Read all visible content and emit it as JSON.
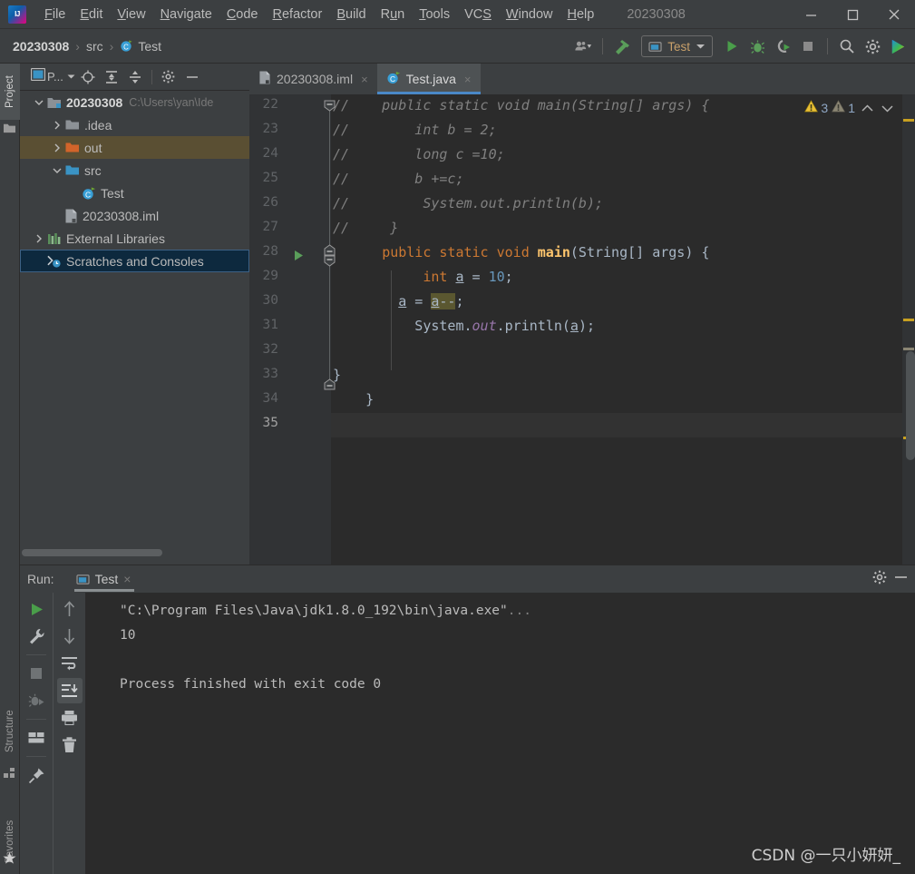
{
  "window": {
    "title": "20230308",
    "app_logo_icon": "intellij-idea-logo",
    "controls": [
      {
        "name": "minimize-button",
        "icon": "minimize-icon"
      },
      {
        "name": "maximize-button",
        "icon": "maximize-icon"
      },
      {
        "name": "close-button",
        "icon": "close-icon"
      }
    ]
  },
  "menubar": {
    "items": [
      {
        "label": "File",
        "mnemonic": "F"
      },
      {
        "label": "Edit",
        "mnemonic": "E"
      },
      {
        "label": "View",
        "mnemonic": "V"
      },
      {
        "label": "Navigate",
        "mnemonic": "N"
      },
      {
        "label": "Code",
        "mnemonic": "C"
      },
      {
        "label": "Refactor",
        "mnemonic": "R"
      },
      {
        "label": "Build",
        "mnemonic": "B"
      },
      {
        "label": "Run",
        "mnemonic": "u"
      },
      {
        "label": "Tools",
        "mnemonic": "T"
      },
      {
        "label": "VCS",
        "mnemonic": "S"
      },
      {
        "label": "Window",
        "mnemonic": "W"
      },
      {
        "label": "Help",
        "mnemonic": "H"
      }
    ]
  },
  "breadcrumb": {
    "items": [
      {
        "label": "20230308",
        "bold": true,
        "icon": ""
      },
      {
        "label": "src",
        "bold": false,
        "icon": ""
      },
      {
        "label": "Test",
        "bold": false,
        "icon": "java-class-icon"
      }
    ],
    "separator": "›"
  },
  "toolbar": {
    "buttons": [
      {
        "name": "user-settings-button",
        "icon": "person-dropdown-icon"
      },
      {
        "name": "build-project-button",
        "icon": "hammer-icon"
      },
      {
        "name": "run-button",
        "icon": "run-play-icon"
      },
      {
        "name": "debug-button",
        "icon": "debug-bug-icon"
      },
      {
        "name": "run-with-coverage-button",
        "icon": "coverage-icon"
      },
      {
        "name": "stop-button",
        "icon": "stop-square-icon"
      },
      {
        "name": "search-everywhere-button",
        "icon": "search-icon"
      },
      {
        "name": "settings-button",
        "icon": "gear-icon"
      },
      {
        "name": "idea-help-button",
        "icon": "idea-arrow-icon"
      }
    ],
    "run_config": {
      "label": "Test",
      "icon": "run-config-icon",
      "chevron": "chevron-down-icon"
    }
  },
  "left_tool_strip": {
    "top": [
      {
        "label": "Project",
        "icon": "project-folder-icon",
        "active": true
      }
    ],
    "bottom": [
      {
        "label": "Structure",
        "icon": "structure-icon",
        "active": false
      },
      {
        "label": "Favorites",
        "icon": "star-icon",
        "active": false
      }
    ]
  },
  "project_panel": {
    "title": "P...",
    "header_buttons": [
      {
        "name": "project-view-selector",
        "icon": "project-view-icon"
      },
      {
        "name": "scroll-from-source-button",
        "icon": "target-crosshair-icon"
      },
      {
        "name": "expand-all-button",
        "icon": "expand-all-icon"
      },
      {
        "name": "collapse-all-button",
        "icon": "collapse-all-icon"
      },
      {
        "name": "panel-settings-button",
        "icon": "gear-icon"
      },
      {
        "name": "hide-panel-button",
        "icon": "minimize-icon"
      }
    ],
    "tree": [
      {
        "label": "20230308",
        "secondary": "C:\\Users\\yan\\Ide",
        "icon": "module-folder-icon",
        "arrow": "chevron-down-icon",
        "depth": 0,
        "bold": true,
        "state": "normal"
      },
      {
        "label": ".idea",
        "secondary": "",
        "icon": "folder-gray-icon",
        "arrow": "chevron-right-icon",
        "depth": 1,
        "bold": false,
        "state": "normal"
      },
      {
        "label": "out",
        "secondary": "",
        "icon": "folder-orange-icon",
        "arrow": "chevron-right-icon",
        "depth": 1,
        "bold": false,
        "state": "selected-inactive"
      },
      {
        "label": "src",
        "secondary": "",
        "icon": "folder-source-icon",
        "arrow": "chevron-down-icon",
        "depth": 1,
        "bold": false,
        "state": "normal"
      },
      {
        "label": "Test",
        "secondary": "",
        "icon": "java-class-icon",
        "arrow": "",
        "depth": 2,
        "bold": false,
        "state": "normal"
      },
      {
        "label": "20230308.iml",
        "secondary": "",
        "icon": "iml-file-icon",
        "arrow": "",
        "depth": 1,
        "bold": false,
        "state": "normal"
      },
      {
        "label": "External Libraries",
        "secondary": "",
        "icon": "libraries-icon",
        "arrow": "chevron-right-icon",
        "depth": 0,
        "bold": false,
        "state": "normal"
      },
      {
        "label": "Scratches and Consoles",
        "secondary": "",
        "icon": "scratches-icon",
        "arrow": "",
        "depth": 0,
        "bold": false,
        "state": "selected-focused"
      }
    ]
  },
  "editor": {
    "tabs": [
      {
        "label": "20230308.iml",
        "icon": "iml-file-icon",
        "active": false,
        "close": "×"
      },
      {
        "label": "Test.java",
        "icon": "java-class-icon",
        "active": true,
        "close": "×"
      }
    ],
    "first_line_number": 22,
    "lines": [
      {
        "n": 22,
        "text": "//    public static void main(String[] args) {"
      },
      {
        "n": 23,
        "text": "//        int b = 2;"
      },
      {
        "n": 24,
        "text": "//        long c =10;"
      },
      {
        "n": 25,
        "text": "//        b +=c;"
      },
      {
        "n": 26,
        "text": "//         System.out.println(b);"
      },
      {
        "n": 27,
        "text": "//    }"
      },
      {
        "n": 28,
        "text": "    public static void main(String[] args) {"
      },
      {
        "n": 29,
        "text": "        int a = 10;"
      },
      {
        "n": 30,
        "text": "        a = a--;"
      },
      {
        "n": 31,
        "text": "        System.out.println(a);"
      },
      {
        "n": 32,
        "text": ""
      },
      {
        "n": 33,
        "text": "}"
      },
      {
        "n": 34,
        "text": "    }"
      },
      {
        "n": 35,
        "text": ""
      }
    ],
    "caret_line": 35,
    "highlighted_token": "a--",
    "inspections": {
      "warnings_count": "3",
      "weak_warnings_count": "1",
      "warning_icon": "warning-triangle-yellow-icon",
      "weak_icon": "warning-triangle-gray-icon",
      "prev_icon": "chevron-up-icon",
      "next_icon": "chevron-down-icon"
    }
  },
  "run_panel": {
    "label": "Run:",
    "tab": {
      "label": "Test",
      "icon": "run-config-icon",
      "close": "×"
    },
    "header_buttons": [
      {
        "name": "run-settings-button",
        "icon": "gear-icon"
      },
      {
        "name": "hide-run-panel-button",
        "icon": "minimize-icon"
      }
    ],
    "toolbar_left": [
      {
        "name": "rerun-button",
        "icon": "run-play-icon"
      },
      {
        "name": "edit-configuration-button",
        "icon": "wrench-icon"
      },
      {
        "name": "stop-process-button",
        "icon": "stop-square-icon"
      },
      {
        "name": "resume-program-button",
        "icon": "debug-rerun-icon"
      },
      {
        "name": "layout-settings-button",
        "icon": "layout-icon"
      },
      {
        "name": "pin-tab-button",
        "icon": "pin-icon"
      }
    ],
    "toolbar_right": [
      {
        "name": "up-stacktrace-button",
        "icon": "arrow-up-icon"
      },
      {
        "name": "down-stacktrace-button",
        "icon": "arrow-down-icon"
      },
      {
        "name": "soft-wrap-button",
        "icon": "soft-wrap-icon"
      },
      {
        "name": "scroll-to-end-button",
        "icon": "scroll-to-end-icon",
        "active": true
      },
      {
        "name": "print-button",
        "icon": "printer-icon"
      },
      {
        "name": "clear-all-button",
        "icon": "trash-icon"
      }
    ],
    "console": {
      "command": "\"C:\\Program Files\\Java\\jdk1.8.0_192\\bin\\java.exe\"",
      "command_ellipsis": "...",
      "output": "10",
      "blank": "",
      "exit": "Process finished with exit code 0"
    }
  },
  "watermark": {
    "text": "CSDN @一只小妍妍_"
  },
  "colors": {
    "bg_panel": "#3c3f41",
    "bg_editor": "#2b2b2b",
    "gutter": "#313335",
    "accent_blue": "#4a88c7",
    "keyword_orange": "#cc7832",
    "method_yellow": "#ffc66d",
    "number_blue": "#6897bb",
    "field_purple": "#9876aa",
    "comment_gray": "#808080",
    "text_default": "#a9b7c6",
    "warning_yellow": "#e8bf36",
    "selection_olive": "#5a5730",
    "selection_blue": "#0d293e",
    "selection_brown": "#5a4f33",
    "run_green": "#5a9e5a"
  }
}
